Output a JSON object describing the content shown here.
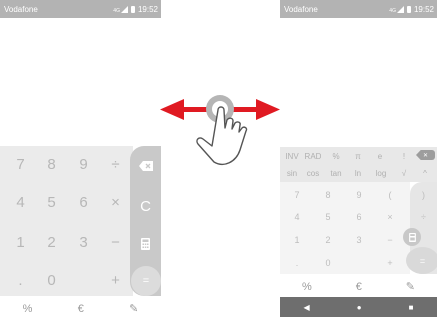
{
  "left_screen": {
    "status": {
      "carrier": "Vodafone",
      "network": "4G",
      "time": "19:52"
    },
    "digits": [
      "7",
      "8",
      "9",
      "4",
      "5",
      "6",
      "1",
      "2",
      "3",
      ".",
      "0"
    ],
    "ops": {
      "divide": "÷",
      "multiply": "×",
      "minus": "−",
      "plus": "+"
    },
    "side": {
      "clear": "C",
      "equals": "="
    },
    "tabs": {
      "percent": "%",
      "currency": "€",
      "edit": "✎"
    }
  },
  "right_screen": {
    "status": {
      "carrier": "Vodafone",
      "network": "4G",
      "time": "19:52"
    },
    "sci_row1": [
      "INV",
      "RAD",
      "%",
      "π",
      "e",
      "!"
    ],
    "sci_row2": [
      "sin",
      "cos",
      "tan",
      "ln",
      "log",
      "√",
      "^"
    ],
    "keys": [
      [
        "7",
        "8",
        "9",
        "(",
        ")"
      ],
      [
        "4",
        "5",
        "6",
        "×",
        "÷"
      ],
      [
        "1",
        "2",
        "3",
        "−",
        ""
      ],
      [
        ".",
        "0",
        "",
        "+",
        ""
      ]
    ],
    "equals": "=",
    "tabs": {
      "percent": "%",
      "currency": "€",
      "edit": "✎"
    },
    "nav": {
      "back": "◀",
      "home": "●",
      "recents": "■"
    }
  },
  "gesture": {
    "icon": "swipe-hand-icon",
    "arrow_color": "#e01a22"
  }
}
